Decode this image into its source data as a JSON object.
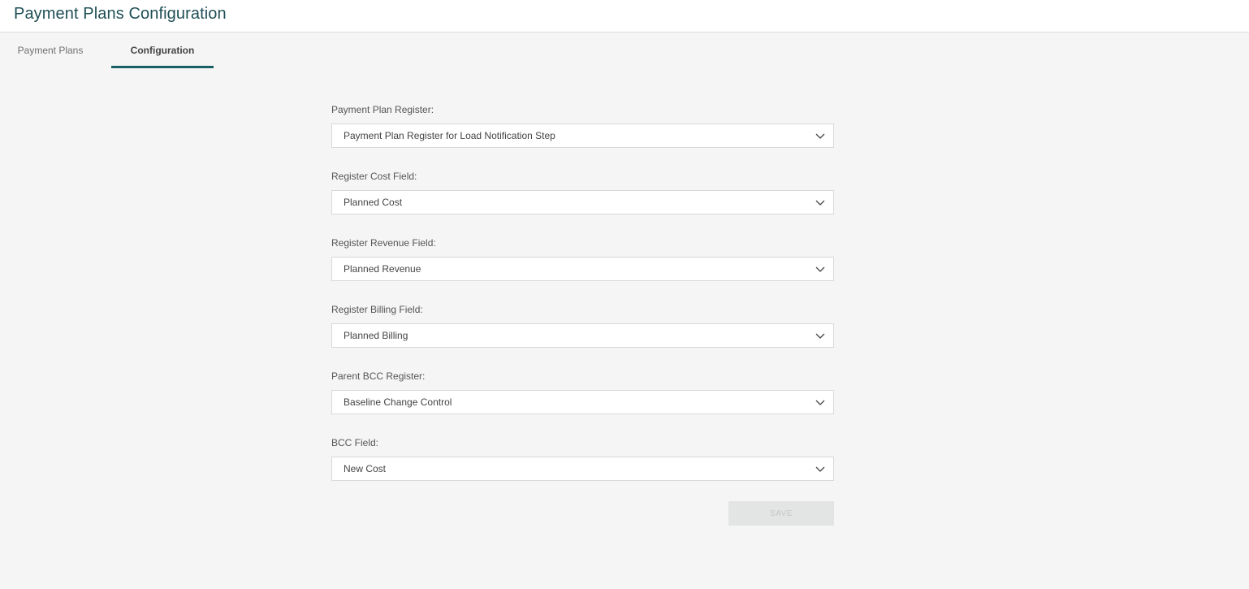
{
  "header": {
    "title": "Payment Plans Configuration"
  },
  "tabs": [
    {
      "label": "Payment Plans",
      "active": false
    },
    {
      "label": "Configuration",
      "active": true
    }
  ],
  "form": {
    "fields": [
      {
        "label": "Payment Plan Register:",
        "value": "Payment Plan Register for Load Notification Step"
      },
      {
        "label": "Register Cost Field:",
        "value": "Planned Cost"
      },
      {
        "label": "Register Revenue Field:",
        "value": "Planned Revenue"
      },
      {
        "label": "Register Billing Field:",
        "value": "Planned Billing"
      },
      {
        "label": "Parent BCC Register:",
        "value": "Baseline Change Control"
      },
      {
        "label": "BCC Field:",
        "value": "New Cost"
      }
    ],
    "save_label": "SAVE"
  },
  "colors": {
    "accent": "#1a5f63",
    "title": "#1f4f56",
    "background": "#f4f5f4"
  }
}
